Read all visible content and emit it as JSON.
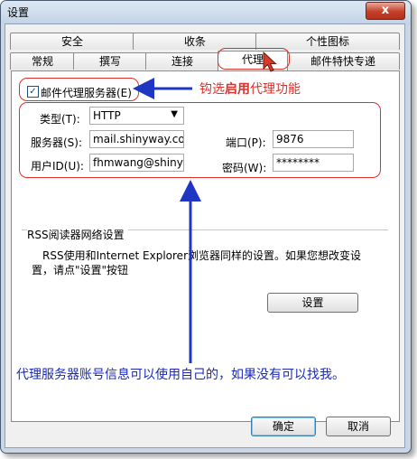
{
  "window": {
    "title": "设置",
    "close_glyph": "x"
  },
  "tabs_row1": [
    "安全",
    "收条",
    "个性图标"
  ],
  "tabs_row2": [
    "常规",
    "撰写",
    "连接",
    "代理",
    "邮件特快专递"
  ],
  "proxy": {
    "enable_label": "邮件代理服务器(E)",
    "enable_checked": true,
    "type_label": "类型(T):",
    "type_value": "HTTP",
    "server_label": "服务器(S):",
    "server_value": "mail.shinyway.com",
    "port_label": "端口(P):",
    "port_value": "9876",
    "user_label": "用户ID(U):",
    "user_value": "fhmwang@shinyway",
    "password_label": "密码(W):",
    "password_value": "********"
  },
  "rss": {
    "group_title": "RSS阅读器网络设置",
    "description_line1": "RSS使用和Internet Explorer浏览器同样的设置。如果您想改变设",
    "description_line2": "置，请点\"设置\"按钮",
    "settings_button": "设置"
  },
  "annotations": {
    "top_prefix": "钩选",
    "top_bold": "启用",
    "top_suffix": "代理功能",
    "bottom": "代理服务器账号信息可以使用自己的，如果没有可以找我。"
  },
  "footer": {
    "ok": "确定",
    "cancel": "取消"
  },
  "colors": {
    "annotation_red": "#e0302a",
    "annotation_blue": "#1a2ab8",
    "arrow_blue": "#1f35c4"
  }
}
